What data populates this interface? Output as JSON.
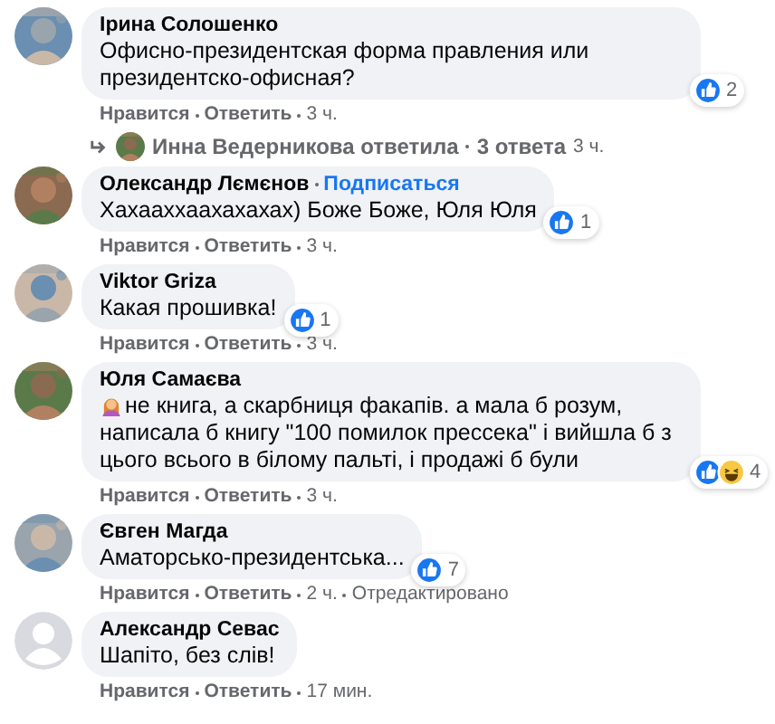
{
  "comments": [
    {
      "author": "Ірина Солошенко",
      "avatar_photo": true,
      "text": "Офисно-президентская форма правления или президентско-офисная?",
      "reactions": [
        {
          "kind": "like"
        }
      ],
      "count": "2",
      "like": "Нравится",
      "reply": "Ответить",
      "time": "3 ч.",
      "replies": {
        "author_line": "Инна Ведерникова ответила",
        "count": "3 ответа",
        "time": "3 ч."
      }
    },
    {
      "author": "Олександр Лємєнов",
      "follow": "Подписаться",
      "avatar_photo": true,
      "text": "Хахааххаахахахах) Боже Боже, Юля Юля",
      "reactions": [
        {
          "kind": "like"
        }
      ],
      "count": "1",
      "like": "Нравится",
      "reply": "Ответить",
      "time": "3 ч."
    },
    {
      "author": "Viktor Griza",
      "avatar_photo": true,
      "text": "Какая прошивка!",
      "reactions": [
        {
          "kind": "like"
        }
      ],
      "count": "1",
      "like": "Нравится",
      "reply": "Ответить",
      "time": "3 ч."
    },
    {
      "author": "Юля Самаєва",
      "avatar_photo": true,
      "emoji": true,
      "text": "не книга, а скарбниця факапів. а мала б розум, написала б книгу \"100 помилок прессека\" і вийшла б з цього всього в білому пальті, і продажі б були",
      "reactions": [
        {
          "kind": "like"
        },
        {
          "kind": "haha"
        }
      ],
      "count": "4",
      "like": "Нравится",
      "reply": "Ответить",
      "time": "3 ч."
    },
    {
      "author": "Євген Магда",
      "avatar_photo": true,
      "text": "Аматорсько-президентська...",
      "reactions": [
        {
          "kind": "like"
        }
      ],
      "count": "7",
      "like": "Нравится",
      "reply": "Ответить",
      "time": "2 ч.",
      "edited": "Отредактировано"
    },
    {
      "author": "Александр Севас",
      "avatar_photo": false,
      "text": "Шапіто, без слів!",
      "like": "Нравится",
      "reply": "Ответить",
      "time": "17 мин."
    }
  ]
}
